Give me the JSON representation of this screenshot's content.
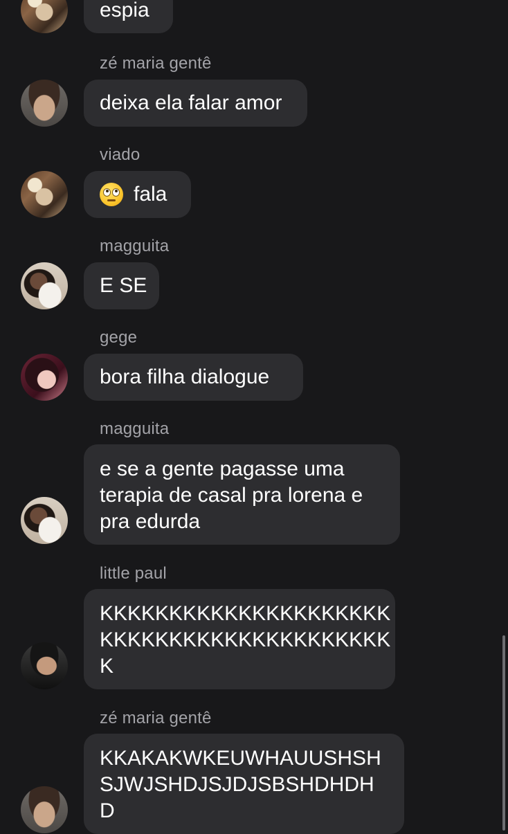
{
  "messages": [
    {
      "sender": "",
      "avatar_icon": "profile-photo",
      "lines": [
        "espia"
      ]
    },
    {
      "sender": "zé maria gentê",
      "avatar_icon": "profile-photo",
      "lines": [
        "deixa ela falar amor"
      ]
    },
    {
      "sender": "viado",
      "avatar_icon": "profile-photo",
      "emoji_icon": "face-with-rolling-eyes",
      "lines": [
        "fala"
      ]
    },
    {
      "sender": "magguita",
      "avatar_icon": "profile-photo",
      "lines": [
        "E SE"
      ]
    },
    {
      "sender": "gege",
      "avatar_icon": "profile-photo",
      "lines": [
        "bora filha dialogue"
      ]
    },
    {
      "sender": "magguita",
      "avatar_icon": "profile-photo",
      "lines": [
        "e se a gente pagasse uma",
        "terapia de casal pra lorena e",
        "pra edurda"
      ]
    },
    {
      "sender": "little paul",
      "avatar_icon": "profile-photo",
      "lines": [
        "KKKKKKKKKKKKKKKKKKKKK",
        "KKKKKKKKKKKKKKKKKKKKK",
        "K"
      ]
    },
    {
      "sender": "zé maria gentê",
      "avatar_icon": "profile-photo",
      "lines": [
        "KKAKAKWKEUWHAUUSHSH",
        "SJWJSHDJSJDJSBSHDHDH",
        "D"
      ]
    }
  ],
  "colors": {
    "background": "#18181a",
    "bubble": "#2d2d30",
    "sender_text": "#a3a3a8",
    "message_text": "#ffffff"
  }
}
